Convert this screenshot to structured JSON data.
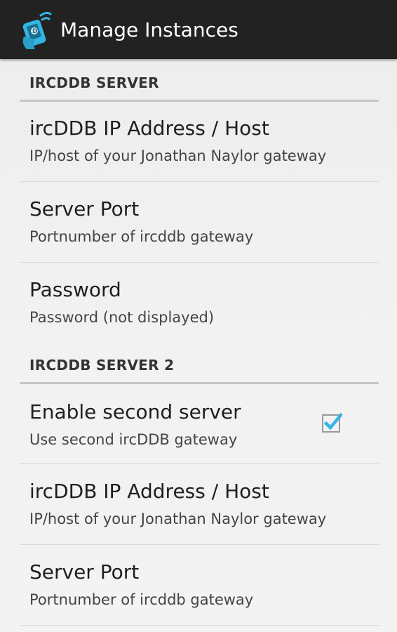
{
  "action_bar": {
    "icon": "app-antenna-phone-icon",
    "title": "Manage Instances"
  },
  "sections": [
    {
      "header": "IRCDDB SERVER",
      "items": [
        {
          "title": "ircDDB IP Address / Host",
          "summary": "IP/host of your Jonathan Naylor gateway"
        },
        {
          "title": "Server Port",
          "summary": "Portnumber of ircddb gateway"
        },
        {
          "title": "Password",
          "summary": "Password (not displayed)"
        }
      ]
    },
    {
      "header": "IRCDDB SERVER 2",
      "items": [
        {
          "title": "Enable second server",
          "summary": "Use second ircDDB gateway",
          "checkbox": true,
          "checked": true
        },
        {
          "title": "ircDDB IP Address / Host",
          "summary": "IP/host of your Jonathan Naylor gateway"
        },
        {
          "title": "Server Port",
          "summary": "Portnumber of ircddb gateway"
        }
      ]
    }
  ],
  "colors": {
    "action_bar": "#222222",
    "accent": "#33b5e5",
    "background": "#efefef"
  }
}
